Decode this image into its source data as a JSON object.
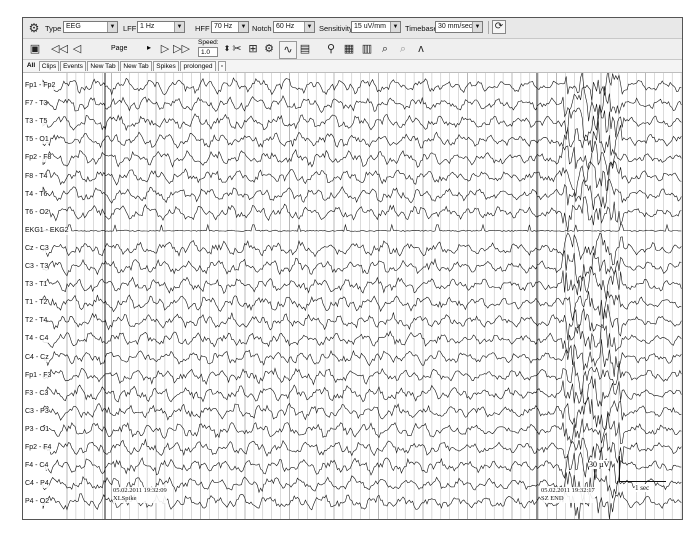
{
  "toolbar": {
    "type_label": "Type",
    "type_value": "EEG",
    "lff_label": "LFF",
    "lff_value": "1 Hz",
    "hff_label": "HFF",
    "hff_value": "70 Hz",
    "notch_label": "Notch",
    "notch_value": "60 Hz",
    "sensitivity_label": "Sensitivity",
    "sensitivity_value": "15 uV/mm",
    "timebase_label": "Timebase",
    "timebase_value": "30 mm/sec"
  },
  "playback": {
    "page_label": "Page",
    "speed_label": "Speed:",
    "speed_value": "1.0"
  },
  "tabs": [
    "All",
    "Clips",
    "Events",
    "New Tab",
    "New Tab",
    "Spikes",
    "prolonged"
  ],
  "channels": [
    "Fp1 - Fp2",
    "F7 - T3",
    "T3 - T5",
    "T5 - O1",
    "Fp2 - F8",
    "F8 - T4",
    "T4 - T6",
    "T6 - O2",
    "EKG1 - EKG2",
    "Cz - C3",
    "C3 - T3",
    "T3 - T1",
    "T1 - T2",
    "T2 - T4",
    "T4 - C4",
    "C4 - Cz",
    "Fp1 - F3",
    "F3 - C3",
    "C3 - P3",
    "P3 - O1",
    "Fp2 - F4",
    "F4 - C4",
    "C4 - P4",
    "P4 - O2"
  ],
  "events": [
    {
      "date": "05.02.2011 19:32:09",
      "label": "XLSpike"
    },
    {
      "date": "05.02.2011 19:32:17",
      "label": "SZ END"
    }
  ],
  "scale": {
    "amplitude": "30 µV",
    "time": "1 sec"
  },
  "colors": {
    "trace": "#111111",
    "grid": "#9a9a9a",
    "toolbar": "#e8e8e8"
  }
}
